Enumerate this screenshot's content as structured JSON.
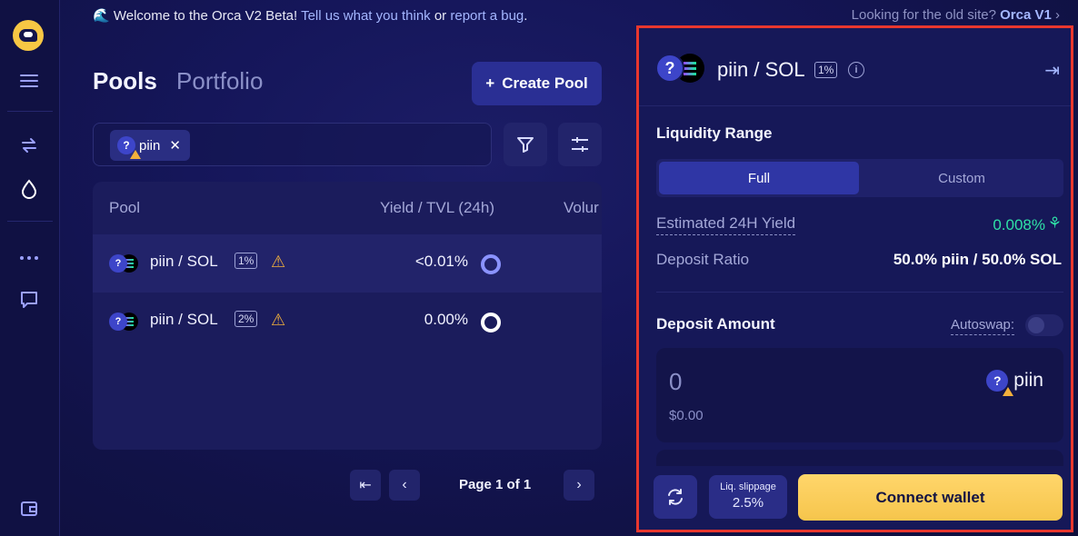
{
  "banner": {
    "welcome": "Welcome to the Orca V2 Beta!",
    "feedback_link": "Tell us what you think",
    "or": "or",
    "bug_link": "report a bug",
    "period": ".",
    "old_site": "Looking for the old site?",
    "old_site_link": "Orca V1"
  },
  "tabs": {
    "pools": "Pools",
    "portfolio": "Portfolio"
  },
  "create_pool": "Create Pool",
  "search": {
    "chip_label": "piin"
  },
  "table": {
    "headers": [
      "Pool",
      "Yield / TVL (24h)",
      "Volur"
    ],
    "rows": [
      {
        "pair": "piin / SOL",
        "fee": "1%",
        "yield": "<0.01%",
        "ring_color": "#8b93ff"
      },
      {
        "pair": "piin / SOL",
        "fee": "2%",
        "yield": "0.00%",
        "ring_color": "#ffffff"
      }
    ]
  },
  "pagination": {
    "text": "Page 1 of 1"
  },
  "panel": {
    "pair": "piin / SOL",
    "fee": "1%",
    "liquidity_range": "Liquidity Range",
    "range_full": "Full",
    "range_custom": "Custom",
    "est_yield_label": "Estimated 24H Yield",
    "est_yield_value": "0.008%",
    "deposit_ratio_label": "Deposit Ratio",
    "deposit_ratio_value": "50.0% piin / 50.0% SOL",
    "deposit_amount": "Deposit Amount",
    "autoswap": "Autoswap:",
    "amount": "0",
    "usd": "$0.00",
    "token": "piin",
    "slippage_label": "Liq. slippage",
    "slippage_value": "2.5%",
    "connect": "Connect wallet"
  },
  "colors": {
    "accent": "#2a2f94",
    "highlight": "#e8372e",
    "cta": "#f6c54c",
    "positive": "#2fe1a6"
  }
}
